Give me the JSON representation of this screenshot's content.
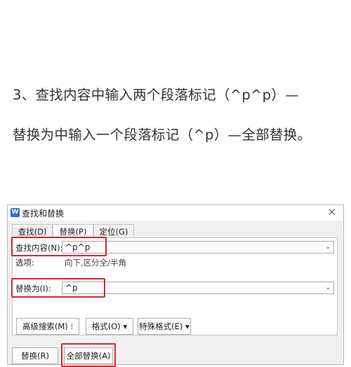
{
  "instructions": {
    "line1": "3、查找内容中输入两个段落标记（^p^p）—",
    "line2": "替换为中输入一个段落标记（^p）—全部替换。"
  },
  "dialog": {
    "app_icon": "W",
    "title": "查找和替换",
    "close_glyph": "✕",
    "tabs": [
      {
        "label": "查找(D)"
      },
      {
        "label": "替换(P)"
      },
      {
        "label": "定位(G)"
      }
    ],
    "active_tab": "替换(P)",
    "find_label": "查找内容(N):",
    "find_value": "^p^p",
    "options_label": "选项:",
    "options_value": "向下,区分全/半角",
    "replace_label": "替换为(I):",
    "replace_value": "^p",
    "dropdown_glyph": "⌄",
    "buttons": {
      "advanced_search": "高级搜索(M) ⁝",
      "format": "格式(O)  ▾",
      "special_format": "特殊格式(E) ▾",
      "replace": "替换(R)",
      "replace_all": "全部替换(A)"
    }
  }
}
